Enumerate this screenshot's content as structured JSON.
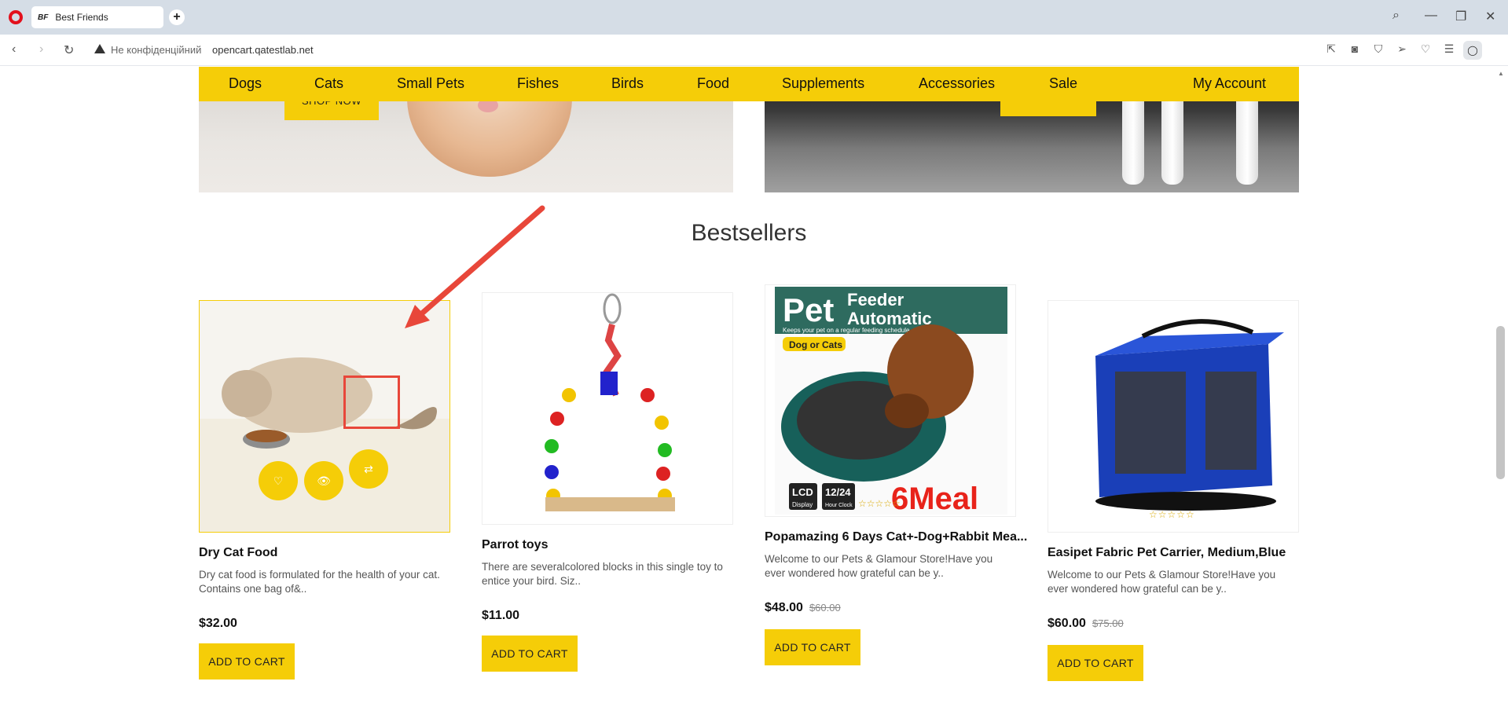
{
  "browser": {
    "tab_title": "Best Friends",
    "tab_favicon": "BF",
    "security_label": "Не конфіденційний",
    "url": "opencart.qatestlab.net"
  },
  "nav": {
    "items": [
      "Dogs",
      "Cats",
      "Small Pets",
      "Fishes",
      "Birds",
      "Food",
      "Supplements",
      "Accessories",
      "Sale",
      "My Account"
    ]
  },
  "banner": {
    "shop_now": "SHOP NOW"
  },
  "section": {
    "title": "Bestsellers"
  },
  "products": [
    {
      "name": "Dry Cat Food",
      "description": "Dry cat food is formulated for the health of your cat. Contains one bag of&..",
      "price": "$32.00",
      "old_price": "",
      "cart_label": "ADD TO CART"
    },
    {
      "name": "Parrot toys",
      "description": "There are severalcolored blocks in this single toy to entice your bird. Siz..",
      "price": "$11.00",
      "old_price": "",
      "cart_label": "ADD TO CART"
    },
    {
      "name": "Popamazing 6 Days Cat+-Dog+Rabbit Mea...",
      "description": "Welcome to our Pets & Glamour Store!Have you ever wondered how grateful can be y..",
      "price": "$48.00",
      "old_price": "$60.00",
      "cart_label": "ADD TO CART",
      "image_text": {
        "title_a": "Pet",
        "title_b": "Feeder",
        "title_c": "Automatic",
        "tagline": "Keeps your pet on a regular feeding schedule",
        "badge": "Dog or Cats",
        "lcd_a": "LCD",
        "lcd_b": "Display",
        "clock_a": "12/24",
        "clock_b": "Hour Clock",
        "meal": "6Meal"
      }
    },
    {
      "name": "Easipet Fabric Pet Carrier, Medium,Blue",
      "description": "Welcome to our Pets & Glamour Store!Have you ever wondered how grateful can be y..",
      "price": "$60.00",
      "old_price": "$75.00",
      "cart_label": "ADD TO CART"
    }
  ],
  "hover_actions": [
    "heart-icon",
    "eye-icon",
    "compare-icon"
  ],
  "colors": {
    "accent": "#f5cd08",
    "annotation": "#e8473a"
  }
}
